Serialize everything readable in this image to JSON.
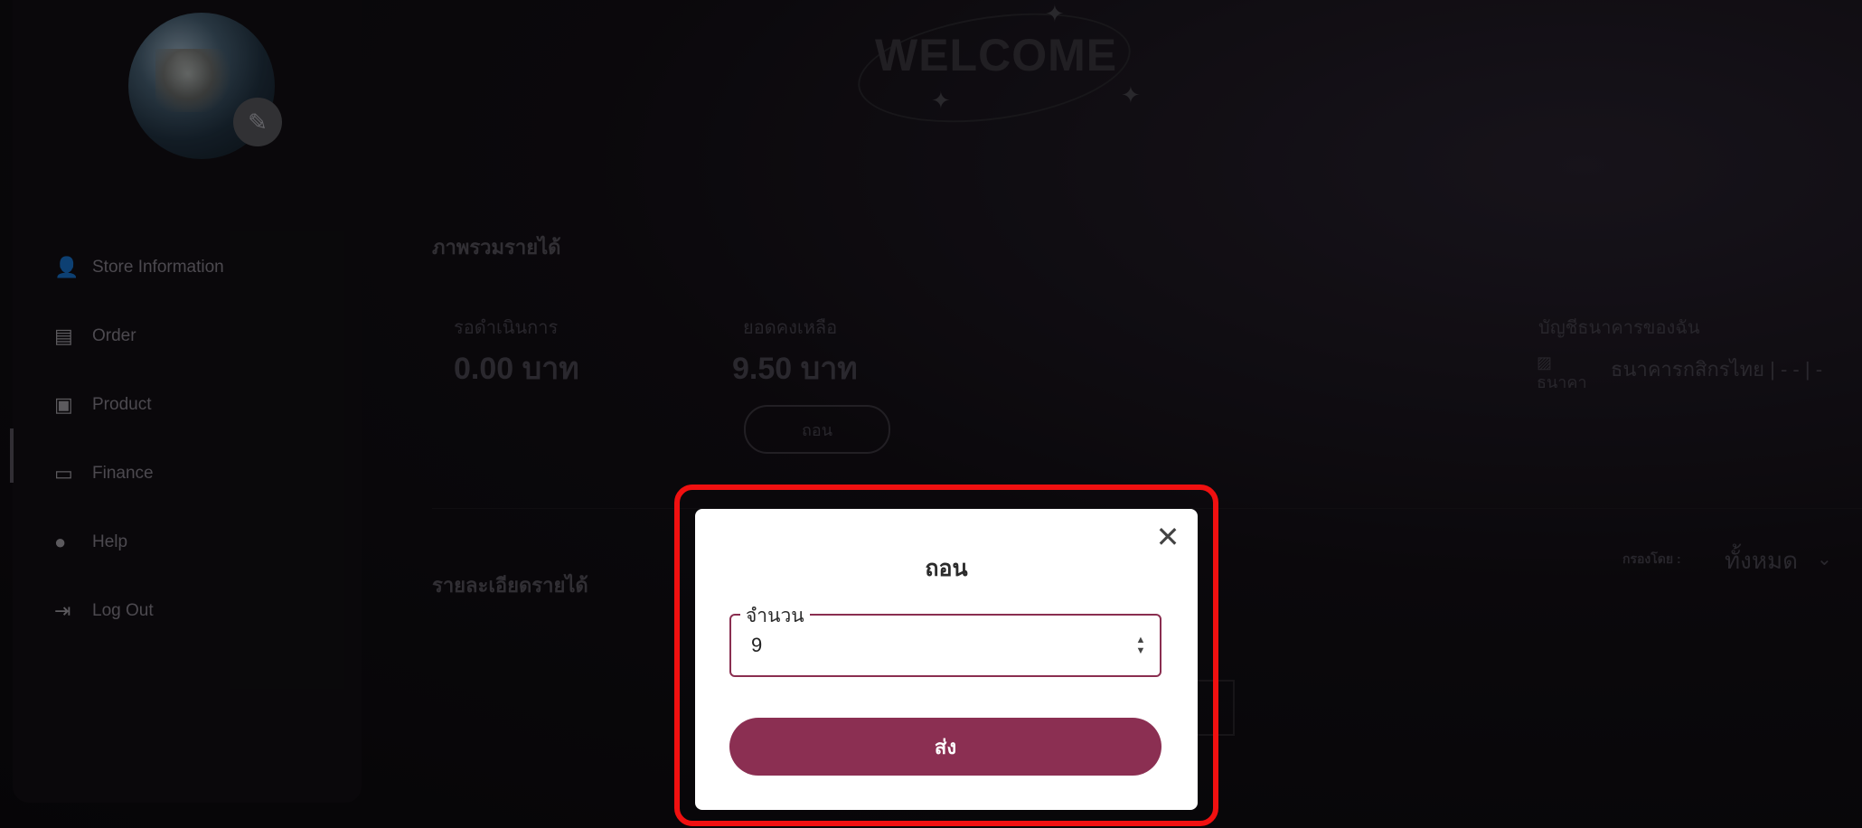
{
  "header": {
    "welcome": "WELCOME"
  },
  "sidebar": {
    "items": [
      {
        "label": "Store Information",
        "icon": "user-icon"
      },
      {
        "label": "Order",
        "icon": "clipboard-icon"
      },
      {
        "label": "Product",
        "icon": "bag-icon"
      },
      {
        "label": "Finance",
        "icon": "money-icon",
        "active": true
      },
      {
        "label": "Help",
        "icon": "help-icon"
      },
      {
        "label": "Log Out",
        "icon": "logout-icon"
      }
    ]
  },
  "overview": {
    "title": "ภาพรวมรายได้",
    "pending_label": "รอดำเนินการ",
    "pending_amount": "0.00 บาท",
    "balance_label": "ยอดคงเหลือ",
    "balance_amount": "9.50 บาท",
    "withdraw_button": "ถอน",
    "bank_label": "บัญชีธนาคารของฉัน",
    "bank_image_alt": "ธนาคา",
    "bank_name": "ธนาคารกสิกรไทย | - - | -"
  },
  "details": {
    "title": "รายละเอียดรายได้",
    "filter_label": "กรองโดย :",
    "filter_value": "ทั้งหมด"
  },
  "modal": {
    "title": "ถอน",
    "field_label": "จำนวน",
    "field_value": "9",
    "submit_label": "ส่ง"
  },
  "colors": {
    "accent": "#8b2f52",
    "highlight": "#f01010"
  }
}
